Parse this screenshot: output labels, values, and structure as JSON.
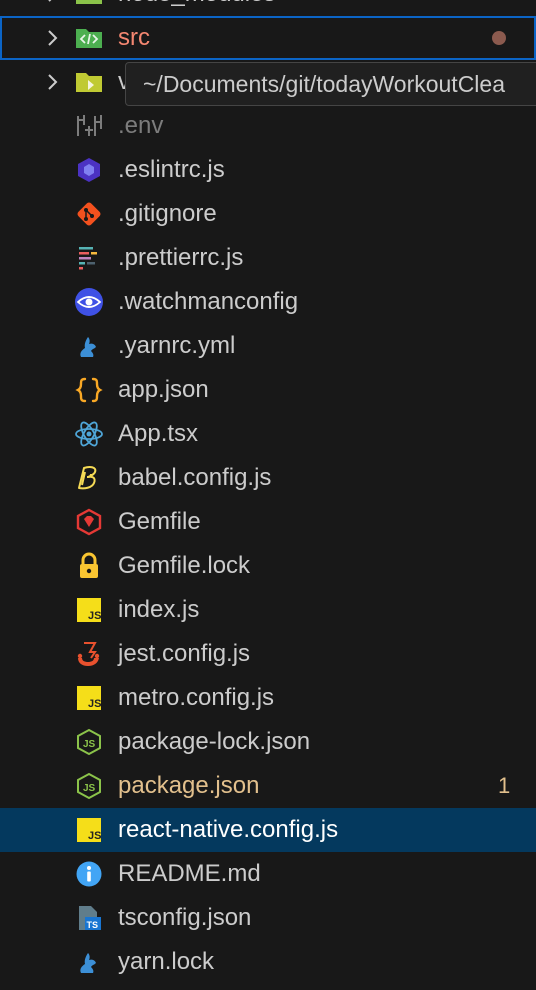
{
  "explorer": {
    "partial_top_label": "node_modules",
    "folders": [
      {
        "label": "src",
        "status": "error"
      },
      {
        "label": "v"
      }
    ],
    "tooltip": "~/Documents/git/todayWorkoutClea",
    "files": [
      {
        "label": ".env",
        "icon": "env-settings-icon"
      },
      {
        "label": ".eslintrc.js",
        "icon": "eslint-icon"
      },
      {
        "label": ".gitignore",
        "icon": "git-icon"
      },
      {
        "label": ".prettierrc.js",
        "icon": "prettier-icon"
      },
      {
        "label": ".watchmanconfig",
        "icon": "watchman-icon"
      },
      {
        "label": ".yarnrc.yml",
        "icon": "yarn-icon"
      },
      {
        "label": "app.json",
        "icon": "json-braces-icon"
      },
      {
        "label": "App.tsx",
        "icon": "react-icon"
      },
      {
        "label": "babel.config.js",
        "icon": "babel-icon"
      },
      {
        "label": "Gemfile",
        "icon": "ruby-gem-icon"
      },
      {
        "label": "Gemfile.lock",
        "icon": "lock-icon"
      },
      {
        "label": "index.js",
        "icon": "javascript-icon"
      },
      {
        "label": "jest.config.js",
        "icon": "jest-icon"
      },
      {
        "label": "metro.config.js",
        "icon": "javascript-icon"
      },
      {
        "label": "package-lock.json",
        "icon": "nodejs-icon"
      },
      {
        "label": "package.json",
        "icon": "nodejs-icon",
        "badge": "1"
      },
      {
        "label": "react-native.config.js",
        "icon": "javascript-icon"
      },
      {
        "label": "README.md",
        "icon": "info-icon"
      },
      {
        "label": "tsconfig.json",
        "icon": "tsconfig-icon"
      },
      {
        "label": "yarn.lock",
        "icon": "yarn-icon"
      }
    ]
  },
  "colors": {
    "background": "#181818",
    "selected_row": "#04395e",
    "focus_border": "#0b64c6",
    "modified_text": "#e2c08d",
    "error_text": "#f48771",
    "javascript_yellow": "#f5de19",
    "react_blue": "#4fa6d8"
  }
}
